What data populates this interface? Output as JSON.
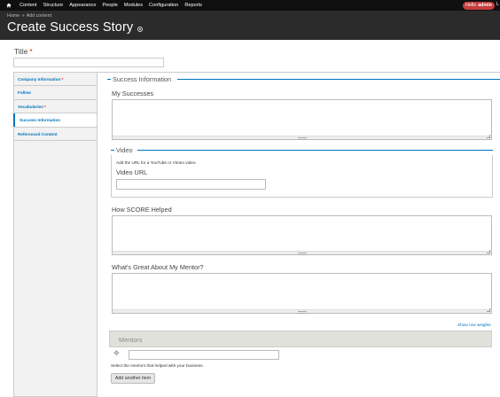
{
  "toolbar": {
    "items": [
      "Content",
      "Structure",
      "Appearance",
      "People",
      "Modules",
      "Configuration",
      "Reports"
    ],
    "hello_prefix": "Hello",
    "user": "admin",
    "logout_fragment": "L"
  },
  "header": {
    "breadcrumb": [
      "Home",
      "Add content"
    ],
    "breadcrumb_separator": "»",
    "title": "Create Success Story"
  },
  "title_field": {
    "label": "Title",
    "required_mark": "*",
    "value": ""
  },
  "vertical_tabs": [
    {
      "label": "Company Information",
      "required": true
    },
    {
      "label": "Follow",
      "required": false
    },
    {
      "label": "Vocabularies",
      "required": true
    },
    {
      "label": "Success Information",
      "required": false,
      "active": true
    },
    {
      "label": "Referenced Content",
      "required": false
    }
  ],
  "success_information": {
    "legend": "Success Information",
    "my_successes_label": "My Successes",
    "video": {
      "legend": "Video",
      "description": "Add the URL for a YouTube or Vimeo video.",
      "url_label": "Video URL",
      "url_value": ""
    },
    "how_score_label": "How SCORE Helped",
    "mentor_label": "What's Great About My Mentor?",
    "show_row_weights": "Show row weights",
    "mentors": {
      "label": "Mentors",
      "value": "",
      "description": "Select the mentors that helped with your business.",
      "add_button": "Add another item"
    }
  }
}
